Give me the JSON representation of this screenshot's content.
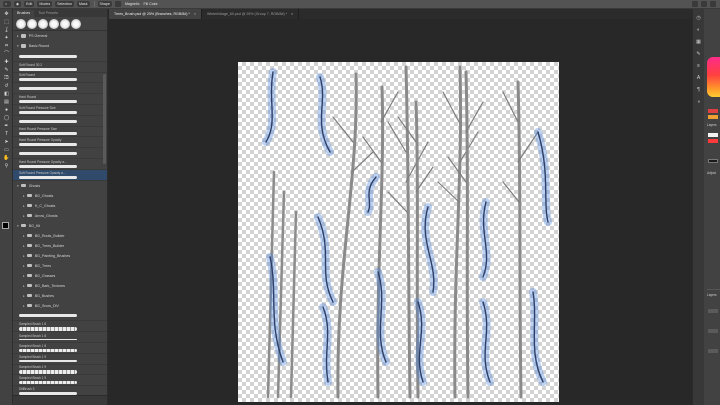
{
  "optionsbar": {
    "items": [
      "Edit",
      "Modes",
      "Selection",
      "Mask",
      "Shape",
      "Magnetic",
      "Fill Color"
    ]
  },
  "tools": {
    "icons": [
      "move-icon",
      "marquee-icon",
      "lasso-icon",
      "magic-wand-icon",
      "crop-icon",
      "eyedropper-icon",
      "healing-icon",
      "brush-icon",
      "stamp-icon",
      "history-brush-icon",
      "eraser-icon",
      "gradient-icon",
      "blur-icon",
      "dodge-icon",
      "pen-icon",
      "type-icon",
      "path-select-icon",
      "shape-icon",
      "hand-icon",
      "zoom-icon"
    ],
    "glyphs": [
      "✥",
      "⬚",
      "ʆ",
      "✦",
      "⌗",
      "⌒",
      "✚",
      "✎",
      "⎄",
      "↺",
      "◧",
      "▤",
      "●",
      "◯",
      "✒",
      "T",
      "➤",
      "▭",
      "✋",
      "⚲"
    ]
  },
  "brush_panel": {
    "tabs": [
      "Brushes",
      "Tool Presets"
    ],
    "folders": [
      {
        "label": "PS General",
        "expanded": false
      },
      {
        "label": "Basic Round",
        "expanded": true
      }
    ],
    "entries": [
      {
        "label": "",
        "style": "stroke"
      },
      {
        "label": "Soft Round 30 2",
        "style": "stroke"
      },
      {
        "label": "Soft Round",
        "style": "stroke"
      },
      {
        "label": "",
        "style": "stroke"
      },
      {
        "label": "Hard Round",
        "style": "stroke"
      },
      {
        "label": "Soft Round Pressure Size",
        "style": "stroke"
      },
      {
        "label": "",
        "style": "stroke"
      },
      {
        "label": "Hard Round Pressure Size",
        "style": "stroke"
      },
      {
        "label": "Hard Round Pressure Opacity",
        "style": "stroke"
      },
      {
        "label": "",
        "style": "stroke"
      },
      {
        "label": "Hard Round Pressure Opacity a...",
        "style": "stroke"
      },
      {
        "label": "Soft Round Pressure Opacity a...",
        "style": "stroke"
      }
    ],
    "subfolders": [
      {
        "label": "Ghosts",
        "level": 0
      },
      {
        "label": "BG_Ghosts",
        "level": 1
      },
      {
        "label": "H_C_Ghosts",
        "level": 1
      },
      {
        "label": "Arrow_Ghosts",
        "level": 1
      },
      {
        "label": "BG_Kit",
        "level": 0
      },
      {
        "label": "BG_Roots_Builder",
        "level": 1
      },
      {
        "label": "BG_Trees_Builder",
        "level": 1
      },
      {
        "label": "BG_Painting_Brushes",
        "level": 1
      },
      {
        "label": "BG_Trees",
        "level": 1
      },
      {
        "label": "BG_Grasses",
        "level": 1
      },
      {
        "label": "BG_Bark_Textures",
        "level": 1
      },
      {
        "label": "BG_Bushes",
        "level": 1
      },
      {
        "label": "BG_Snow_DIV",
        "level": 1
      }
    ],
    "sampled": [
      {
        "label": "",
        "style": "stroke"
      },
      {
        "label": "Sampled Brush 1 8",
        "style": "rough"
      },
      {
        "label": "Sampled Brush 1 8",
        "style": "thin"
      },
      {
        "label": "Sampled Brush 1 8",
        "style": "rough"
      },
      {
        "label": "Sampled Brush 1 9",
        "style": "thin"
      },
      {
        "label": "Sampled Brush 1 9",
        "style": "rough"
      },
      {
        "label": "Sampled Brush 1 9",
        "style": "rough"
      },
      {
        "label": "DiliBrush 3",
        "style": "stroke"
      }
    ]
  },
  "documents": {
    "tabs": [
      {
        "label": "Trees_Brush.psd @ 25% (Branches, RGB/8#) *",
        "active": true
      },
      {
        "label": "Winterfoliage_60.psd @ 25% (Group 7, RGB/8#) *",
        "active": false
      }
    ]
  },
  "right_panel": {
    "labels": [
      "Layers",
      "Adjust",
      "Layers"
    ]
  }
}
